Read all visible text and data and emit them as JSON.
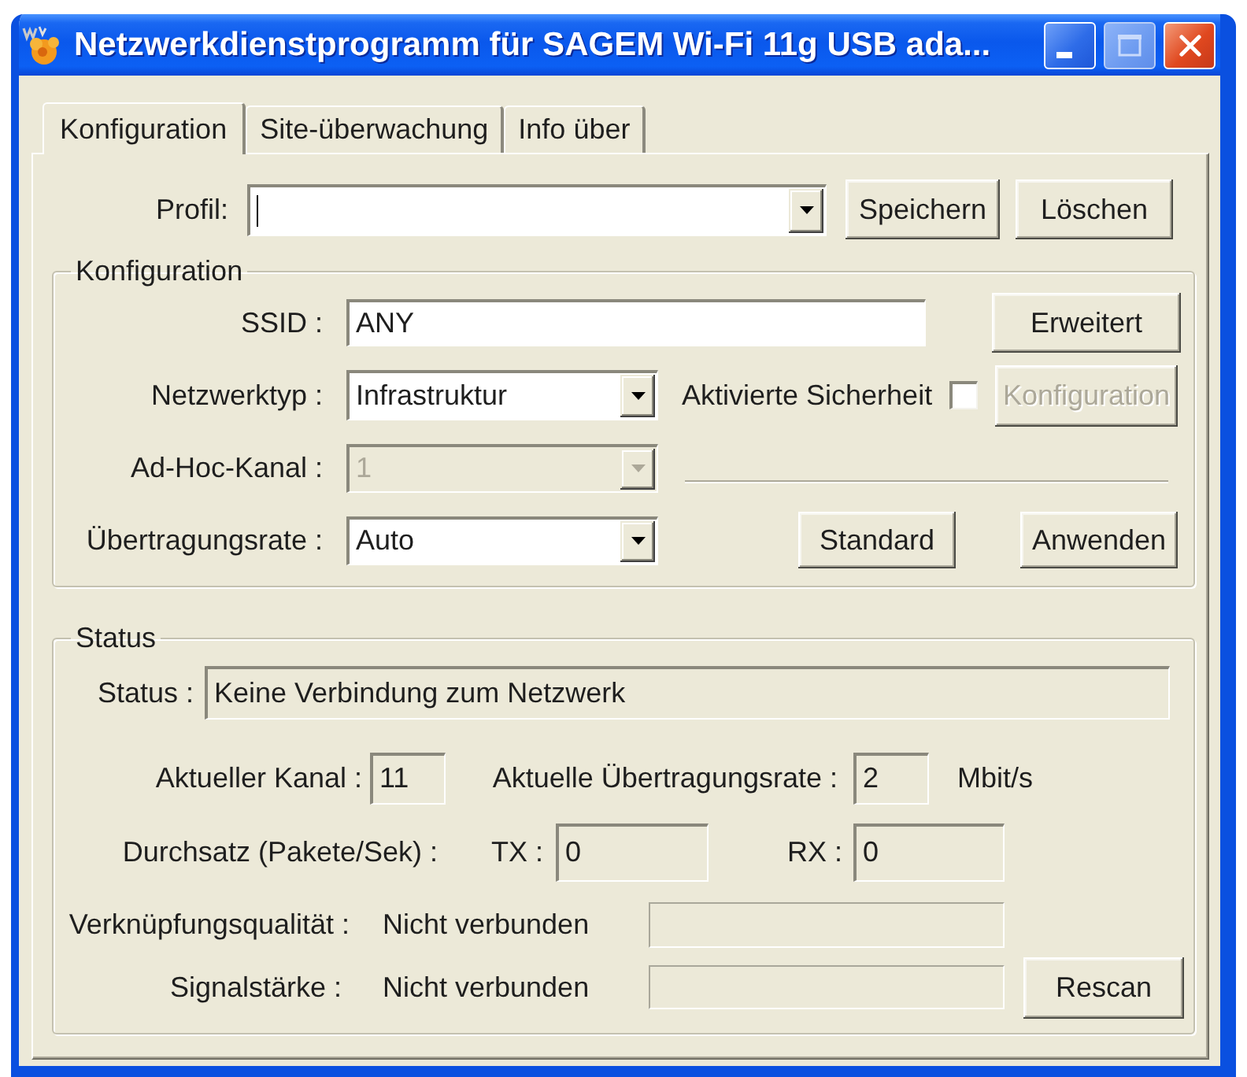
{
  "window": {
    "title": "Netzwerkdienstprogramm für SAGEM Wi-Fi 11g USB ada...",
    "controls": [
      {
        "kind": "minimize",
        "disabled": false
      },
      {
        "kind": "maximize",
        "disabled": true
      },
      {
        "kind": "close",
        "disabled": false
      }
    ]
  },
  "tabs": [
    {
      "label": "Konfiguration",
      "selected": true
    },
    {
      "label": "Site-überwachung",
      "selected": false
    },
    {
      "label": "Info über",
      "selected": false
    }
  ],
  "profile": {
    "label": "Profil:",
    "focused": true,
    "save_button": {
      "label": "Speichern",
      "disabled": false
    },
    "delete_button": {
      "label": "Löschen",
      "disabled": false
    }
  },
  "configuration": {
    "title": "Konfiguration",
    "ssid": {
      "label": "SSID :",
      "value": "ANY"
    },
    "advanced_button": {
      "label": "Erweitert",
      "disabled": false
    },
    "network_type": {
      "label": "Netzwerktyp :",
      "value": "Infrastruktur",
      "disabled": false
    },
    "security": {
      "label": "Aktivierte Sicherheit",
      "checked": false
    },
    "security_button": {
      "label": "Konfiguration",
      "disabled": true
    },
    "adhoc_channel": {
      "label": "Ad-Hoc-Kanal :",
      "value": "1",
      "disabled": true
    },
    "rate": {
      "label": "Übertragungsrate :",
      "value": "Auto",
      "disabled": false
    },
    "default_button": {
      "label": "Standard",
      "disabled": false
    },
    "apply_button": {
      "label": "Anwenden",
      "disabled": false
    }
  },
  "status": {
    "title": "Status",
    "status": {
      "label": "Status :",
      "value": "Keine Verbindung zum Netzwerk"
    },
    "channel": {
      "label": "Aktueller Kanal :",
      "value": "11"
    },
    "rate": {
      "label": "Aktuelle Übertragungsrate :",
      "value": "2",
      "unit": "Mbit/s"
    },
    "throughput": {
      "label": "Durchsatz (Pakete/Sek) :",
      "tx_label": "TX :",
      "tx": "0",
      "rx_label": "RX :",
      "rx": "0"
    },
    "link_quality": {
      "label": "Verknüpfungsqualität :",
      "value": "Nicht verbunden"
    },
    "signal": {
      "label": "Signalstärke :",
      "value": "Nicht verbunden"
    },
    "rescan_button": {
      "label": "Rescan",
      "disabled": false
    }
  }
}
